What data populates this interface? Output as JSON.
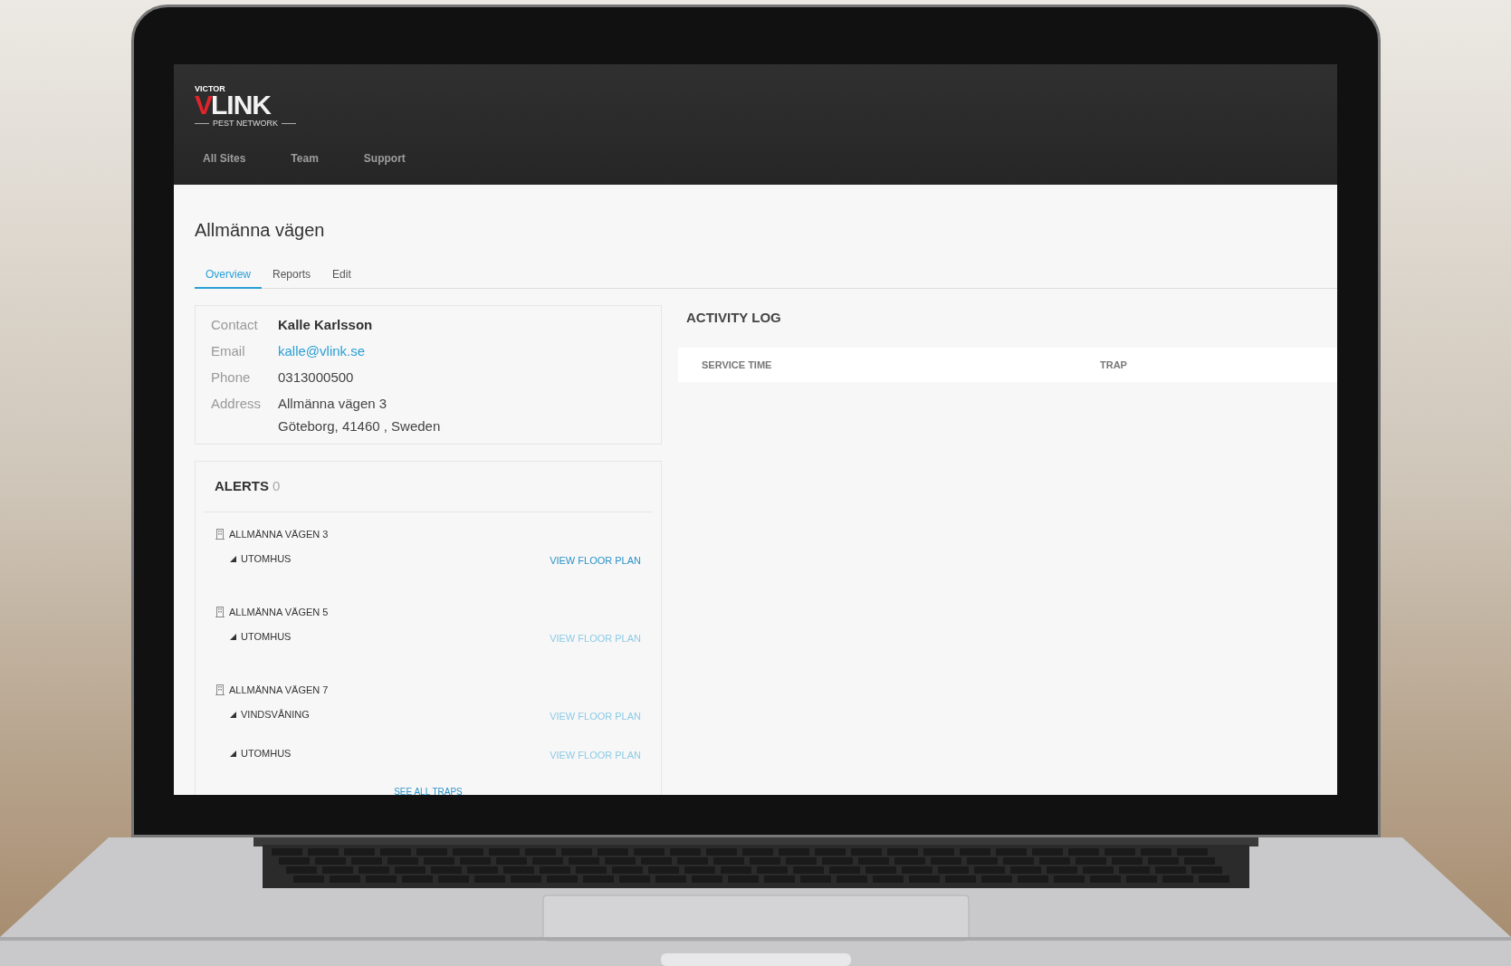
{
  "header": {
    "logo": {
      "brand": "VICTOR",
      "mark": "V",
      "name": "LINK",
      "tagline": "PEST NETWORK"
    },
    "nav": [
      {
        "label": "All Sites"
      },
      {
        "label": "Team"
      },
      {
        "label": "Support"
      }
    ]
  },
  "site": {
    "title": "Allmänna vägen",
    "tabs": [
      {
        "label": "Overview",
        "selected": true
      },
      {
        "label": "Reports",
        "selected": false
      },
      {
        "label": "Edit",
        "selected": false
      }
    ]
  },
  "contact": [
    {
      "label": "Contact",
      "kind": "name",
      "lines": [
        "Kalle Karlsson"
      ]
    },
    {
      "label": "Email",
      "kind": "email",
      "lines": [
        "kalle@vlink.se"
      ]
    },
    {
      "label": "Phone",
      "kind": "text",
      "lines": [
        "0313000500"
      ]
    },
    {
      "label": "Address",
      "kind": "text",
      "lines": [
        "Allmänna vägen 3",
        "Göteborg, 41460 , Sweden"
      ]
    }
  ],
  "alerts": {
    "title": "ALERTS",
    "count": "0",
    "buildings": [
      {
        "name": "ALLMÄNNA VÄGEN 3",
        "floors": [
          {
            "name": "UTOMHUS",
            "link": "VIEW FLOOR PLAN",
            "highlighted": true
          }
        ]
      },
      {
        "name": "ALLMÄNNA VÄGEN 5",
        "floors": [
          {
            "name": "UTOMHUS",
            "link": "VIEW FLOOR PLAN",
            "highlighted": false
          }
        ]
      },
      {
        "name": "ALLMÄNNA VÄGEN 7",
        "floors": [
          {
            "name": "VINDSVÅNING",
            "link": "VIEW FLOOR PLAN",
            "highlighted": false
          },
          {
            "name": "UTOMHUS",
            "link": "VIEW FLOOR PLAN",
            "highlighted": false
          }
        ]
      }
    ],
    "see_all": "SEE ALL TRAPS"
  },
  "activity_log": {
    "title": "ACTIVITY LOG",
    "columns": [
      "SERVICE TIME",
      "TRAP"
    ]
  }
}
